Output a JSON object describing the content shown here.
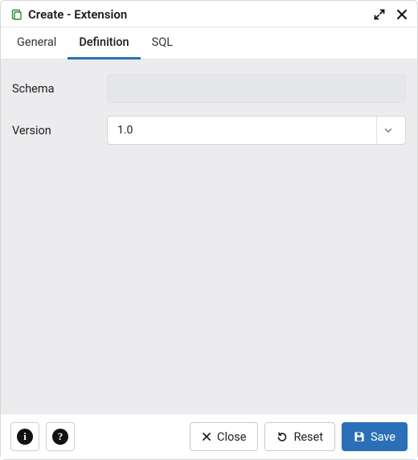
{
  "header": {
    "title": "Create - Extension"
  },
  "tabs": [
    {
      "label": "General",
      "active": false
    },
    {
      "label": "Definition",
      "active": true
    },
    {
      "label": "SQL",
      "active": false
    }
  ],
  "form": {
    "schema": {
      "label": "Schema",
      "value": ""
    },
    "version": {
      "label": "Version",
      "value": "1.0"
    }
  },
  "footer": {
    "close_label": "Close",
    "reset_label": "Reset",
    "save_label": "Save"
  }
}
